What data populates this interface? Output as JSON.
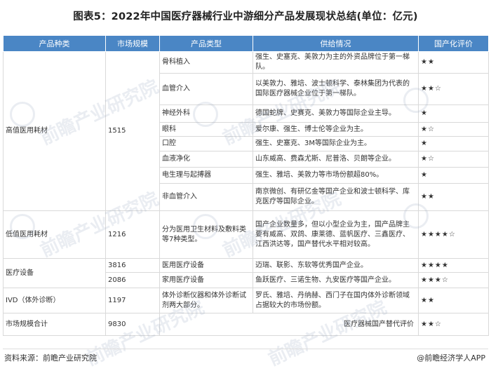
{
  "title": "图表5：2022年中国医疗器械行业中游细分产品发展现状总结(单位：亿元)",
  "headers": [
    "产品种类",
    "市场规模",
    "产品类型",
    "供给情况",
    "国产化评价"
  ],
  "groups": {
    "high": {
      "category": "高值医用耗材",
      "size": "1515"
    },
    "low": {
      "category": "低值医用耗材",
      "size": "1216"
    },
    "device": {
      "category": "医疗设备"
    },
    "ivd": {
      "category": "IVD（体外诊断）",
      "size": "1197"
    },
    "total": {
      "label": "市场规模合计",
      "size": "9830",
      "eval_label": "医疗器械国产替代评价",
      "eval": "★★☆"
    }
  },
  "rows": [
    {
      "type": "骨科植入",
      "supply": "强生、史塞克、美敦力为主的外资品牌位于第一梯队。",
      "rating": "★★"
    },
    {
      "type": "血管介入",
      "supply": "以美敦力、雅培、波士顿科学、泰林集团为代表的国际医疗器械企业位于第一梯队。",
      "rating": "★★☆"
    },
    {
      "type": "神经外科",
      "supply": "德国蛇牌、史赛克、美敦力等国际企业主导。",
      "rating": "★"
    },
    {
      "type": "眼科",
      "supply": "爱尔康、强生、博士伦等企业为主。",
      "rating": "★☆"
    },
    {
      "type": "口腔",
      "supply": "强生、史塞克、3M等国际企业为主。",
      "rating": "★"
    },
    {
      "type": "血液净化",
      "supply": "山东威高、费森尤斯、尼普洛、贝朗等企业。",
      "rating": "★☆"
    },
    {
      "type": "电生理与起搏器",
      "supply": "强生、雅培、美敦力等市场份额超80%。",
      "rating": "★"
    },
    {
      "type": "非血管介入",
      "supply": "南京微创、有研亿金等国产企业和波士顿科学、库克医疗等国际企业。",
      "rating": "★★"
    },
    {
      "type": "分为医用卫生材料及敷料类等7种类型。",
      "supply": "国产企业数量多，但以小型企业为主，国产品牌主要有威高、双鸽、康莱德、蓝帆医疗、三鑫医疗、江西洪达等，国产替代水平相对较高。",
      "rating": "★★★★☆"
    },
    {
      "size": "3816",
      "type": "医用医疗设备",
      "supply": "迈瑞、联影、东软等优秀国产企业。",
      "rating": "★★★★"
    },
    {
      "size": "2086",
      "type": "家用医疗设备",
      "supply": "鱼跃医疗、三诺生物、九安医疗等国产企业。",
      "rating": "★★★☆"
    },
    {
      "type": "体外诊断仪器和体外诊断试剂两大部分。",
      "supply": "罗氏、雅培、丹纳赫、西门子在国内体外诊断领域占据较大的市场份额。",
      "rating": "★★"
    }
  ],
  "footer": {
    "source": "资料来源：前瞻产业研究院",
    "brand": "@前瞻经济学人APP"
  },
  "watermark": "前瞻产业研究院",
  "colors": {
    "header_bg": "#4a86c5",
    "border": "#d9d9d9"
  }
}
